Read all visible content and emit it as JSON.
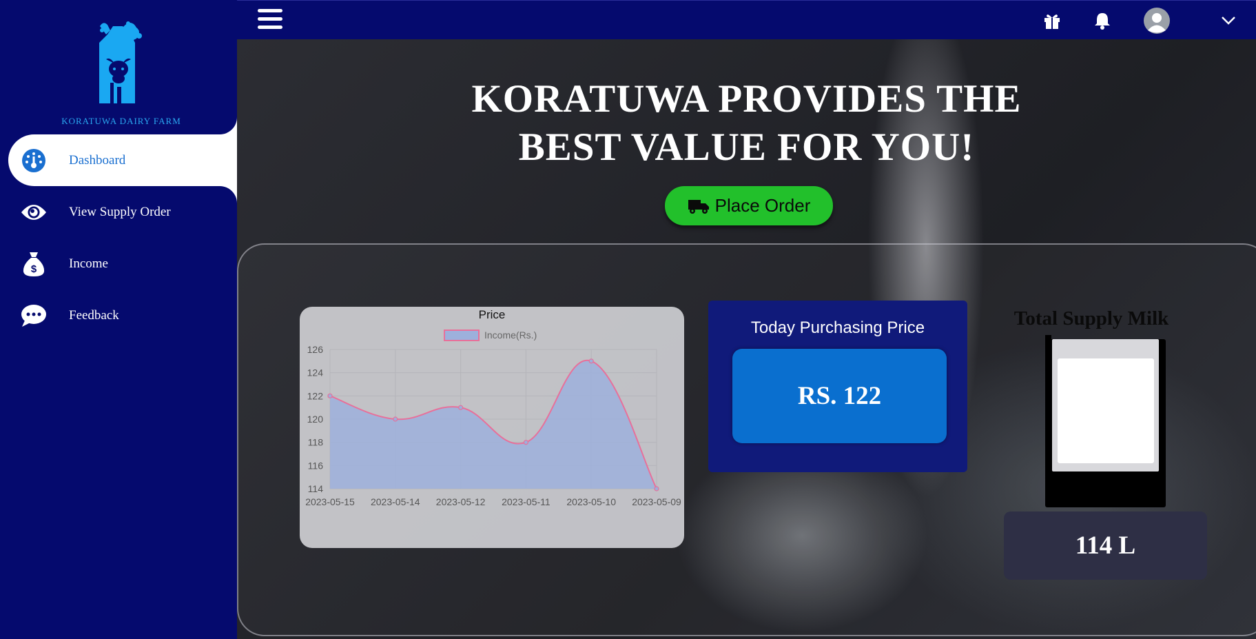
{
  "sidebar": {
    "logo_text": "KORATUWA DAIRY FARM",
    "items": [
      {
        "label": "Dashboard",
        "icon": "dashboard-gauge-icon",
        "active": true
      },
      {
        "label": "View Supply Order",
        "icon": "eye-icon",
        "active": false
      },
      {
        "label": "Income",
        "icon": "money-bag-icon",
        "active": false
      },
      {
        "label": "Feedback",
        "icon": "chat-bubble-icon",
        "active": false
      }
    ]
  },
  "topbar": {
    "icons": [
      "hamburger-menu-icon",
      "gift-icon",
      "bell-icon",
      "user-avatar-icon",
      "chevron-down-icon"
    ]
  },
  "main": {
    "headline_line1": "KORATUWA PROVIDES THE",
    "headline_line2": "BEST VALUE FOR YOU!",
    "place_order_label": "Place Order",
    "price_card": {
      "title": "Today Purchasing Price",
      "value": "RS. 122"
    },
    "supply": {
      "title": "Total Supply Milk",
      "value": "114 L"
    }
  },
  "colors": {
    "sidebar_bg": "#050a6e",
    "active_text": "#1a6fd0",
    "button_green": "#22c02b",
    "price_card_bg": "#101a7a",
    "price_box_bg": "#0a6fcf",
    "chart_line": "#e8709a",
    "chart_fill": "#9db0dc"
  },
  "chart_data": {
    "type": "area",
    "title": "Price",
    "categories": [
      "2023-05-15",
      "2023-05-14",
      "2023-05-12",
      "2023-05-11",
      "2023-05-10",
      "2023-05-09"
    ],
    "series": [
      {
        "name": "Income(Rs.)",
        "values": [
          122,
          120,
          121,
          118,
          125,
          114
        ]
      }
    ],
    "xlabel": "",
    "ylabel": "",
    "ylim": [
      114,
      126
    ],
    "yticks": [
      114,
      116,
      118,
      120,
      122,
      124,
      126
    ],
    "grid": true,
    "legend": "top"
  }
}
